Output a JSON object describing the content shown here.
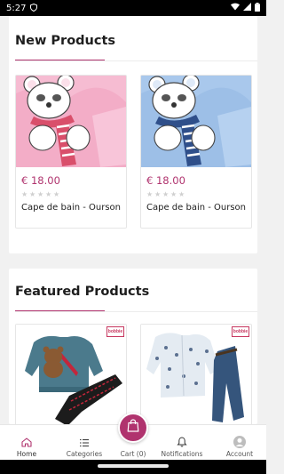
{
  "status_bar": {
    "time": "5:27",
    "app_icon": "shield-icon",
    "icons": [
      "wifi-icon",
      "signal-icon",
      "battery-icon"
    ]
  },
  "sections": {
    "new_products": {
      "title": "New Products",
      "products": [
        {
          "price": "€ 18.00",
          "name": "Cape de bain - Ourson",
          "rating": 0,
          "image": "pink-teddy-bath-cape"
        },
        {
          "price": "€ 18.00",
          "name": "Cape de bain - Ourson",
          "rating": 0,
          "image": "blue-teddy-bath-cape"
        }
      ]
    },
    "featured_products": {
      "title": "Featured Products",
      "products": [
        {
          "image": "blue-sweatshirt-bear-set",
          "badge": "bobbie"
        },
        {
          "image": "printed-shirt-jeans-set",
          "badge": "bobbie"
        }
      ]
    }
  },
  "bottom_nav": {
    "items": [
      {
        "label": "Home",
        "icon": "home-icon",
        "active": true
      },
      {
        "label": "Categories",
        "icon": "list-icon",
        "active": false
      },
      {
        "label": "Cart (0)",
        "icon": "shopping-bag-icon",
        "active": false
      },
      {
        "label": "Notifications",
        "icon": "bell-icon",
        "active": false
      },
      {
        "label": "Account",
        "icon": "account-icon",
        "active": false
      }
    ]
  },
  "colors": {
    "accent": "#b0336e",
    "background": "#f1f1f1",
    "card": "#ffffff"
  }
}
